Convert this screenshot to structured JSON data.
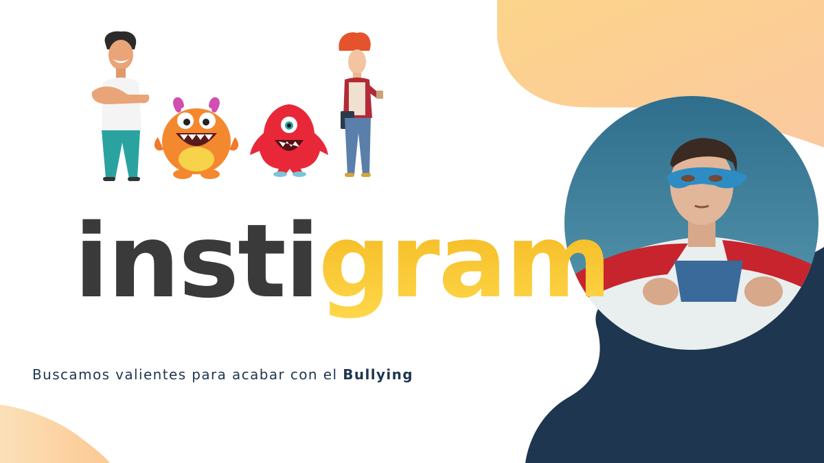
{
  "brand": {
    "name_part1": "insti",
    "name_part2": "gram",
    "color_dark": "#3a3a3a",
    "color_accent_top": "#f2b51d",
    "color_accent_bottom": "#ffd84a"
  },
  "tagline": {
    "text": "Buscamos valientes para acabar con el ",
    "bold": "Bullying"
  },
  "colors": {
    "peach_blob": "#fcd08a",
    "navy_blob": "#1e3650",
    "sky": "#3d7c96"
  },
  "illustrations": [
    "boy-character",
    "orange-monster",
    "red-monster",
    "girl-character",
    "superhero-boy-photo"
  ]
}
